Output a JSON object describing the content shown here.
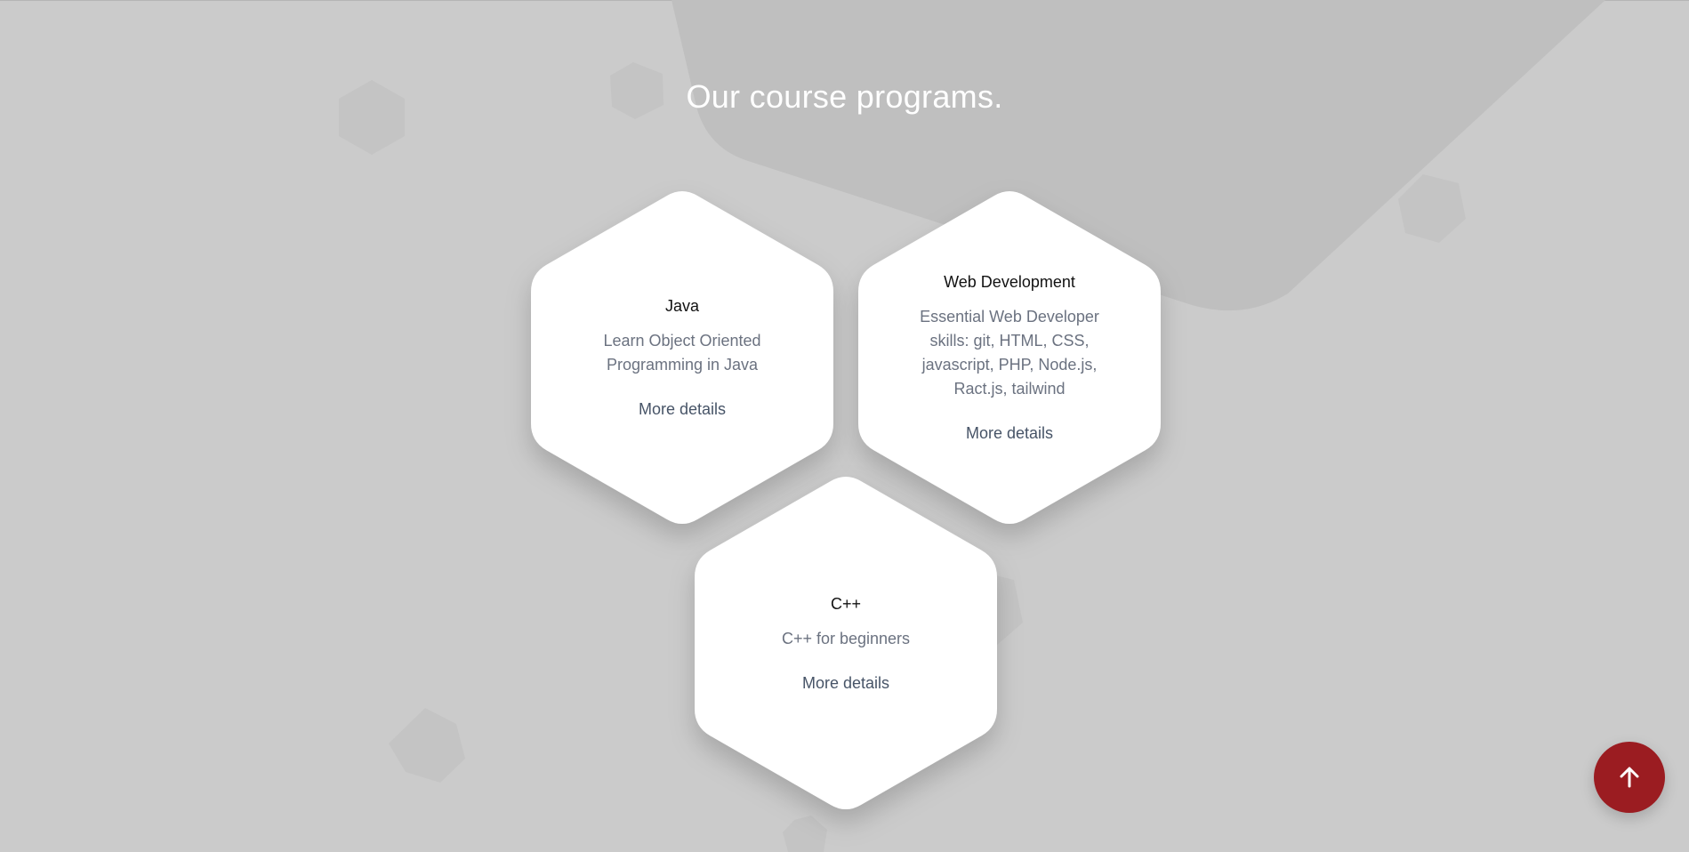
{
  "section": {
    "heading": "Our course programs."
  },
  "courses": [
    {
      "title": "Java",
      "description": "Learn Object Oriented Programming in Java",
      "link_label": "More details"
    },
    {
      "title": "Web Development",
      "description": "Essential Web Developer skills: git, HTML, CSS, javascript, PHP, Node.js, Ract.js, tailwind",
      "link_label": "More details"
    },
    {
      "title": "C++",
      "description": "C++ for beginners",
      "link_label": "More details"
    }
  ],
  "scroll_top_button": {
    "icon": "arrow-up-icon",
    "color": "#9b1c21"
  },
  "colors": {
    "background": "#cbcbcb",
    "card": "#ffffff",
    "accent": "#9b1c21"
  }
}
